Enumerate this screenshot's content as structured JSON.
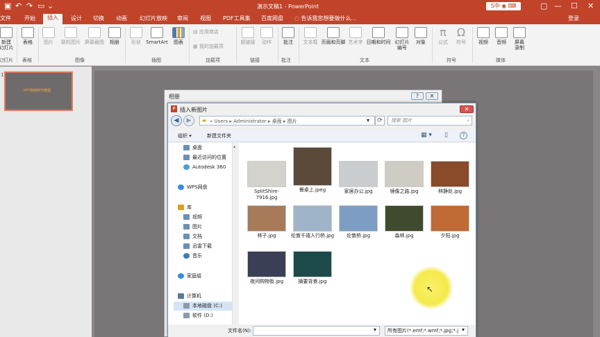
{
  "colors": {
    "accent": "#c0432a",
    "highlight": "#f4ea4a"
  },
  "titlebar": {
    "document_title": "演示文稿1 - PowerPoint",
    "login": "登录",
    "quick_access_icons": [
      "save-icon",
      "undo-icon",
      "redo-icon",
      "start-icon"
    ]
  },
  "tabs": [
    {
      "label": "文件"
    },
    {
      "label": "开始"
    },
    {
      "label": "插入",
      "active": true
    },
    {
      "label": "设计"
    },
    {
      "label": "切换"
    },
    {
      "label": "动画"
    },
    {
      "label": "幻灯片放映"
    },
    {
      "label": "审阅"
    },
    {
      "label": "视图"
    },
    {
      "label": "PDF工具集"
    },
    {
      "label": "百度网盘"
    }
  ],
  "tellme": "告诉我您想要做什么...",
  "ribbon": {
    "new_slide": "新建\n幻灯片",
    "table": "表格",
    "picture": "图片",
    "online_picture": "联机图片",
    "screenshot": "屏幕截图",
    "album": "相册",
    "shapes": "形状",
    "smartart": "SmartArt",
    "chart": "图表",
    "store": "应用商店",
    "my_addins": "我的加载项",
    "hyperlink": "超链接",
    "action": "动作",
    "comment": "批注",
    "textbox": "文本框",
    "header_footer": "页眉和页脚",
    "wordart": "艺术字",
    "datetime": "日期和时间",
    "slide_number": "幻灯片\n编号",
    "object": "对象",
    "equation": "公式",
    "symbol": "符号",
    "video": "视频",
    "audio": "音频",
    "screen_record": "屏幕\n录制",
    "groups": {
      "slides": "幻灯片",
      "tables": "表格",
      "images": "图像",
      "illustrations": "插图",
      "addins": "加载项",
      "links": "链接",
      "comments": "批注",
      "text": "文本",
      "symbols": "符号",
      "media": "媒体"
    }
  },
  "thumb": {
    "number": "1",
    "text": "PPT相册制作教程"
  },
  "album_dialog": {
    "title": "相册"
  },
  "insert_dialog": {
    "title": "插入新图片",
    "breadcrumb": [
      "Users",
      "Administrator",
      "桌面",
      "图片"
    ],
    "search_placeholder": "搜索 图片",
    "organize": "组织 ▾",
    "new_folder": "新建文件夹",
    "nav": [
      "桌面",
      "最近访问的位置",
      "Autodesk 360",
      "WPS网盘",
      "库",
      "视频",
      "图片",
      "文档",
      "迅雷下载",
      "音乐",
      "家庭组",
      "计算机",
      "本地磁盘 (C:)",
      "软件 (D:)"
    ],
    "files": [
      {
        "name": "SplitShire-7916.jpg",
        "color": "#d4d2cc"
      },
      {
        "name": "餐桌上.jpeg",
        "color": "#5b4a3a"
      },
      {
        "name": "家居办公.jpg",
        "color": "#c9cdd0"
      },
      {
        "name": "镜像之路.jpg",
        "color": "#cfccc4"
      },
      {
        "name": "林静处.jpg",
        "color": "#8a4b2a"
      },
      {
        "name": "林子.jpg",
        "color": "#a77a5a"
      },
      {
        "name": "伦敦千禧人行桥.jpg",
        "color": "#9fb4c8"
      },
      {
        "name": "伦敦桥.jpg",
        "color": "#7d9dc4"
      },
      {
        "name": "森林.jpg",
        "color": "#3f4a2e"
      },
      {
        "name": "夕阳.jpg",
        "color": "#c06a35"
      },
      {
        "name": "夜间购物街.jpg",
        "color": "#3a3f55"
      },
      {
        "name": "摘要背景.jpg",
        "color": "#1c4a4a"
      }
    ],
    "filename_label": "文件名(N):",
    "filename_value": "",
    "filetype": "所有图片(*.emf;*.wmf;*.jpg;*.j"
  }
}
